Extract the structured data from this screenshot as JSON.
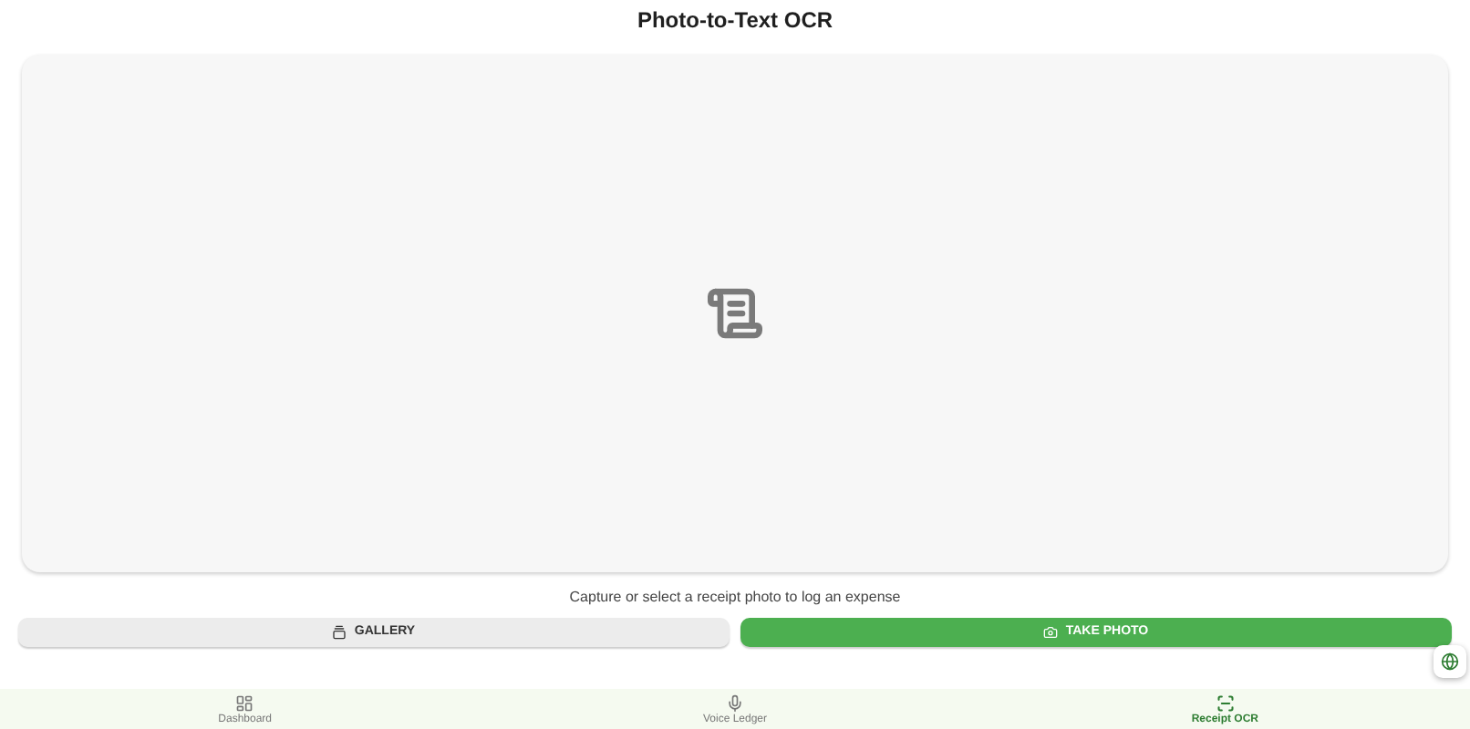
{
  "title": "Photo-to-Text OCR",
  "caption": "Capture or select a receipt photo to log an expense",
  "buttons": [
    {
      "label": "GALLERY",
      "kind": "secondary"
    },
    {
      "label": "TAKE PHOTO",
      "kind": "primary"
    }
  ],
  "nav": [
    {
      "label": "Dashboard",
      "selected": false
    },
    {
      "label": "Voice Ledger",
      "selected": false
    },
    {
      "label": "Receipt OCR",
      "selected": true
    }
  ]
}
